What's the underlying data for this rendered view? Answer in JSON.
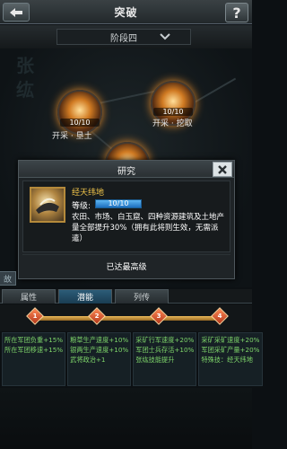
{
  "header": {
    "title": "突破",
    "help_label": "?"
  },
  "stage": {
    "label": "阶段四"
  },
  "tree": {
    "deco_chars": [
      "张",
      "纮"
    ],
    "nodes": [
      {
        "count": "10/10",
        "name": "开采 · 垦土"
      },
      {
        "count": "10/10",
        "name": "开采 · 挖取"
      }
    ]
  },
  "modal": {
    "title": "研究",
    "close_label": "✕",
    "skill_name": "经天纬地",
    "level_label": "等级:",
    "level_value": "10/10",
    "level_fraction": 1.0,
    "description": "农田、市场、白玉窟、四种资源建筑及土地产量全部提升30%（拥有此将则生效，无需派遣）",
    "footer": "已达最高级"
  },
  "side_tab": {
    "label": "故"
  },
  "tabs": [
    {
      "label": "属性",
      "active": false
    },
    {
      "label": "潜能",
      "active": true
    },
    {
      "label": "列传",
      "active": false
    }
  ],
  "track": {
    "markers": [
      "1",
      "2",
      "3",
      "4"
    ]
  },
  "effects": [
    [
      "所在军团负重+15%",
      "所在军团移速+15%"
    ],
    [
      "粮草生产速度+10%",
      "银两生产速度+10%",
      "武将政治+1"
    ],
    [
      "采矿行军速度+20%",
      "军团士兵存活+10%",
      "张纮技能提升"
    ],
    [
      "采矿采矿速度+20%",
      "军团采矿产量+20%",
      "特殊技：经天纬地"
    ]
  ],
  "colors": {
    "accent_gold": "#f2c54a",
    "effect_green": "#7ed56a",
    "active_tab": "#2c5c78"
  }
}
